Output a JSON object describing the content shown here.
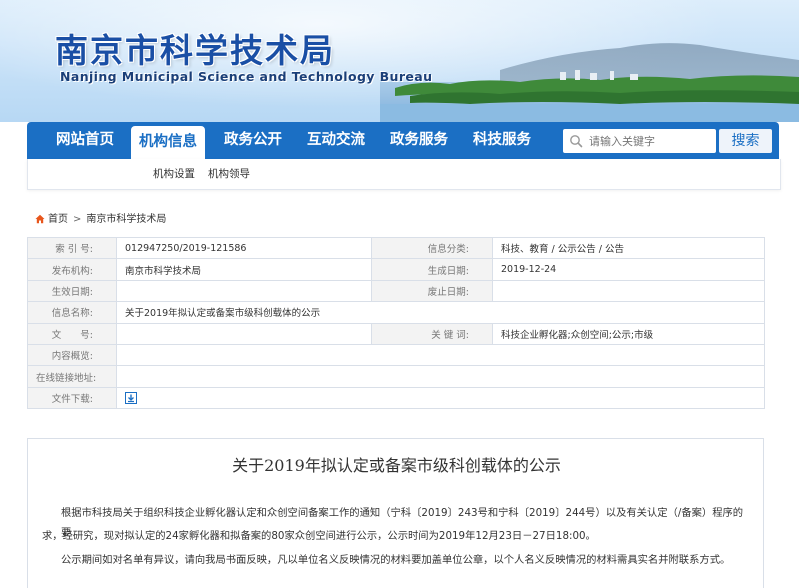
{
  "header": {
    "title": "南京市科学技术局",
    "subtitle": "Nanjing Municipal Science and Technology Bureau"
  },
  "nav": {
    "items": [
      {
        "label": "网站首页",
        "active": false
      },
      {
        "label": "机构信息",
        "active": true
      },
      {
        "label": "政务公开",
        "active": false
      },
      {
        "label": "互动交流",
        "active": false
      },
      {
        "label": "政务服务",
        "active": false
      },
      {
        "label": "科技服务",
        "active": false
      }
    ],
    "search_placeholder": "请输入关键字",
    "search_button": "搜索"
  },
  "subnav": {
    "items": [
      "机构设置",
      "机构领导"
    ]
  },
  "breadcrumb": {
    "home": "首页",
    "separator": ">",
    "current": "南京市科学技术局"
  },
  "info": {
    "index_label": "索 引 号:",
    "index_value": "012947250/2019-121586",
    "category_label": "信息分类:",
    "category_value": "科技、教育 / 公示公告 / 公告",
    "publisher_label": "发布机构:",
    "publisher_value": "南京市科学技术局",
    "created_label": "生成日期:",
    "created_value": "2019-12-24",
    "effective_label": "生效日期:",
    "effective_value": "",
    "abolished_label": "废止日期:",
    "abolished_value": "",
    "name_label": "信息名称:",
    "name_value": "关于2019年拟认定或备案市级科创载体的公示",
    "docno_label": "文　　号:",
    "docno_value": "",
    "keywords_label": "关 键 词:",
    "keywords_value": "科技企业孵化器;众创空间;公示;市级",
    "overview_label": "内容概览:",
    "overview_value": "",
    "online_label": "在线链接地址:",
    "online_value": "",
    "download_label": "文件下载:"
  },
  "article": {
    "title": "关于2019年拟认定或备案市级科创载体的公示",
    "paragraph1_line1": "根据市科技局关于组织科技企业孵化器认定和众创空间备案工作的通知（宁科〔2019〕243号和宁科〔2019〕244号）以及有关认定（/备案）程序的要",
    "paragraph1_line2": "求，经研究，现对拟认定的24家孵化器和拟备案的80家众创空间进行公示，公示时间为2019年12月23日－27日18:00。",
    "paragraph2": "公示期间如对名单有异议，请向我局书面反映，凡以单位名义反映情况的材料要加盖单位公章，以个人名义反映情况的材料需具实名并附联系方式。"
  },
  "colors": {
    "nav_blue": "#1b6fc4",
    "title_blue": "#1a4fa5",
    "label_bg": "#f3f3f3",
    "border": "#d9dfe8",
    "accent_orange": "#e8561c"
  },
  "icons": {
    "search": "search-icon",
    "home": "home-icon",
    "download": "download-icon"
  }
}
